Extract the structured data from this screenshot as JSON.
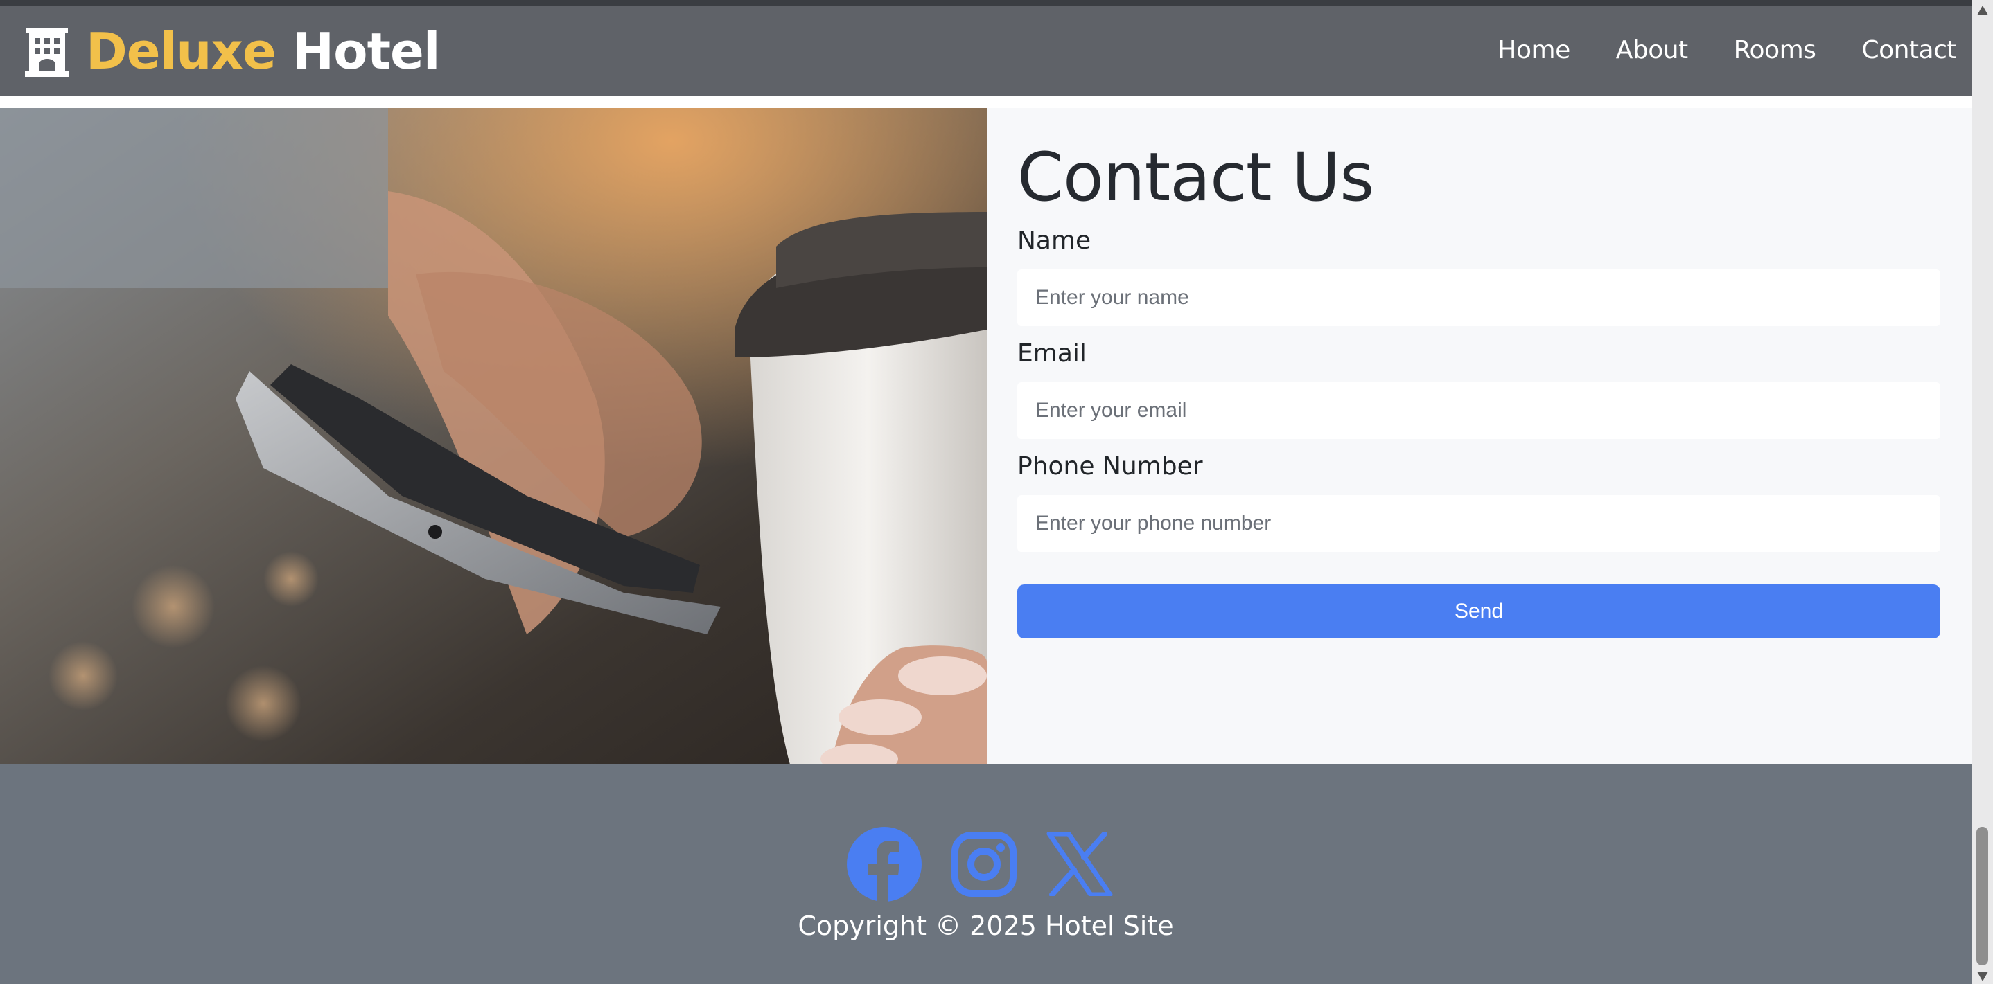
{
  "navbar": {
    "brand_part1": "Deluxe",
    "brand_part2": "Hotel",
    "brand_icon": "hotel-building-icon",
    "links": [
      "Home",
      "About",
      "Rooms",
      "Contact"
    ]
  },
  "contact": {
    "title": "Contact Us",
    "fields": [
      {
        "label": "Name",
        "placeholder": "Enter your name",
        "value": ""
      },
      {
        "label": "Email",
        "placeholder": "Enter your email",
        "value": ""
      },
      {
        "label": "Phone Number",
        "placeholder": "Enter your phone number",
        "value": ""
      }
    ],
    "send_label": "Send"
  },
  "footer": {
    "social_icons": [
      "facebook-icon",
      "instagram-icon",
      "x-twitter-icon"
    ],
    "copyright": "Copyright © 2025 Hotel Site"
  },
  "colors": {
    "brand_accent": "#f2c04a",
    "button_blue": "#4a7ef2",
    "navbar_bg": "#5f6268",
    "footer_bg": "#6c747e"
  }
}
